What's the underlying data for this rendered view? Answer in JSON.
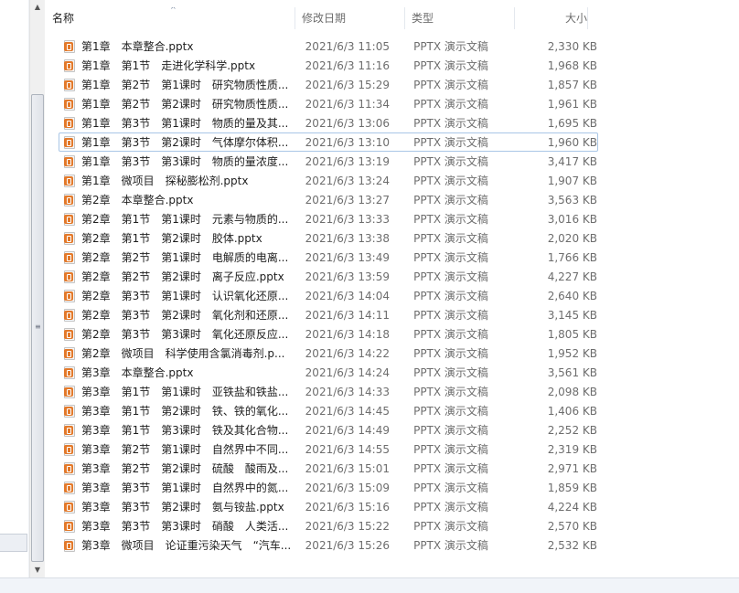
{
  "header": {
    "name_label": "名称",
    "date_label": "修改日期",
    "type_label": "类型",
    "size_label": "大小",
    "sort_icon": "sort-up-icon"
  },
  "files": [
    {
      "name": "第1章　本章整合.pptx",
      "date": "2021/6/3 11:05",
      "type": "PPTX 演示文稿",
      "size": "2,330 KB"
    },
    {
      "name": "第1章　第1节　走进化学科学.pptx",
      "date": "2021/6/3 11:16",
      "type": "PPTX 演示文稿",
      "size": "1,968 KB"
    },
    {
      "name": "第1章　第2节　第1课时　研究物质性质...",
      "date": "2021/6/3 15:29",
      "type": "PPTX 演示文稿",
      "size": "1,857 KB"
    },
    {
      "name": "第1章　第2节　第2课时　研究物质性质...",
      "date": "2021/6/3 11:34",
      "type": "PPTX 演示文稿",
      "size": "1,961 KB"
    },
    {
      "name": "第1章　第3节　第1课时　物质的量及其...",
      "date": "2021/6/3 13:06",
      "type": "PPTX 演示文稿",
      "size": "1,695 KB"
    },
    {
      "name": "第1章　第3节　第2课时　气体摩尔体积...",
      "date": "2021/6/3 13:10",
      "type": "PPTX 演示文稿",
      "size": "1,960 KB"
    },
    {
      "name": "第1章　第3节　第3课时　物质的量浓度...",
      "date": "2021/6/3 13:19",
      "type": "PPTX 演示文稿",
      "size": "3,417 KB"
    },
    {
      "name": "第1章　微项目　探秘膨松剂.pptx",
      "date": "2021/6/3 13:24",
      "type": "PPTX 演示文稿",
      "size": "1,907 KB"
    },
    {
      "name": "第2章　本章整合.pptx",
      "date": "2021/6/3 13:27",
      "type": "PPTX 演示文稿",
      "size": "3,563 KB"
    },
    {
      "name": "第2章　第1节　第1课时　元素与物质的...",
      "date": "2021/6/3 13:33",
      "type": "PPTX 演示文稿",
      "size": "3,016 KB"
    },
    {
      "name": "第2章　第1节　第2课时　胶体.pptx",
      "date": "2021/6/3 13:38",
      "type": "PPTX 演示文稿",
      "size": "2,020 KB"
    },
    {
      "name": "第2章　第2节　第1课时　电解质的电离...",
      "date": "2021/6/3 13:49",
      "type": "PPTX 演示文稿",
      "size": "1,766 KB"
    },
    {
      "name": "第2章　第2节　第2课时　离子反应.pptx",
      "date": "2021/6/3 13:59",
      "type": "PPTX 演示文稿",
      "size": "4,227 KB"
    },
    {
      "name": "第2章　第3节　第1课时　认识氧化还原...",
      "date": "2021/6/3 14:04",
      "type": "PPTX 演示文稿",
      "size": "2,640 KB"
    },
    {
      "name": "第2章　第3节　第2课时　氧化剂和还原...",
      "date": "2021/6/3 14:11",
      "type": "PPTX 演示文稿",
      "size": "3,145 KB"
    },
    {
      "name": "第2章　第3节　第3课时　氧化还原反应...",
      "date": "2021/6/3 14:18",
      "type": "PPTX 演示文稿",
      "size": "1,805 KB"
    },
    {
      "name": "第2章　微项目　科学使用含氯消毒剂.p...",
      "date": "2021/6/3 14:22",
      "type": "PPTX 演示文稿",
      "size": "1,952 KB"
    },
    {
      "name": "第3章　本章整合.pptx",
      "date": "2021/6/3 14:24",
      "type": "PPTX 演示文稿",
      "size": "3,561 KB"
    },
    {
      "name": "第3章　第1节　第1课时　亚铁盐和铁盐...",
      "date": "2021/6/3 14:33",
      "type": "PPTX 演示文稿",
      "size": "2,098 KB"
    },
    {
      "name": "第3章　第1节　第2课时　铁、铁的氧化...",
      "date": "2021/6/3 14:45",
      "type": "PPTX 演示文稿",
      "size": "1,406 KB"
    },
    {
      "name": "第3章　第1节　第3课时　铁及其化合物...",
      "date": "2021/6/3 14:49",
      "type": "PPTX 演示文稿",
      "size": "2,252 KB"
    },
    {
      "name": "第3章　第2节　第1课时　自然界中不同...",
      "date": "2021/6/3 14:55",
      "type": "PPTX 演示文稿",
      "size": "2,319 KB"
    },
    {
      "name": "第3章　第2节　第2课时　硫酸　酸雨及...",
      "date": "2021/6/3 15:01",
      "type": "PPTX 演示文稿",
      "size": "2,971 KB"
    },
    {
      "name": "第3章　第3节　第1课时　自然界中的氮...",
      "date": "2021/6/3 15:09",
      "type": "PPTX 演示文稿",
      "size": "1,859 KB"
    },
    {
      "name": "第3章　第3节　第2课时　氨与铵盐.pptx",
      "date": "2021/6/3 15:16",
      "type": "PPTX 演示文稿",
      "size": "4,224 KB"
    },
    {
      "name": "第3章　第3节　第3课时　硝酸　人类活...",
      "date": "2021/6/3 15:22",
      "type": "PPTX 演示文稿",
      "size": "2,570 KB"
    },
    {
      "name": "第3章　微项目　论证重污染天气　“汽车...",
      "date": "2021/6/3 15:26",
      "type": "PPTX 演示文稿",
      "size": "2,532 KB"
    }
  ],
  "focused_row_index": 5,
  "icons": {
    "file": "pptx-file-icon",
    "scroll_up": "scroll-up-arrow-icon",
    "scroll_down": "scroll-down-arrow-icon"
  },
  "colors": {
    "file_icon_accent": "#e3792a",
    "focus_border": "#a9c6e6",
    "header_text": "#4c607a"
  }
}
